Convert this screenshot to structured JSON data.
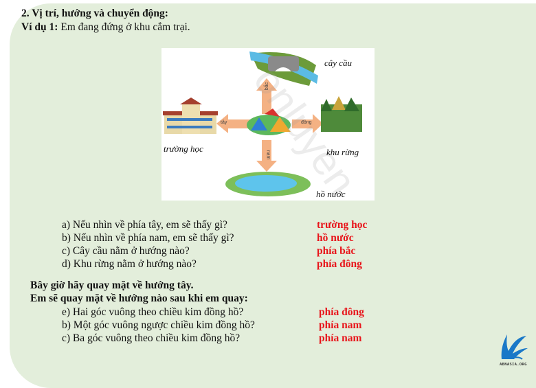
{
  "heading": {
    "title": "2. Vị trí, hướng và chuyển động:",
    "example_label": "Ví dụ 1:",
    "example_text": " Em đang đứng ở khu cắm trại."
  },
  "diagram": {
    "labels": {
      "north_place": "cây cầu",
      "west_place": "trường học",
      "east_place": "khu rừng",
      "south_place": "hồ nước"
    },
    "arrows": {
      "north": "bắc",
      "south": "nam",
      "west": "tây",
      "east": "đông"
    },
    "arrow_color": "#f4b183"
  },
  "questions": [
    {
      "q": "a) Nếu nhìn về phía tây, em sẽ thấy gì?",
      "a": "trường học"
    },
    {
      "q": "b) Nếu nhìn về phía nam, em sẽ thấy gì?",
      "a": "hồ nước"
    },
    {
      "q": "c) Cây cầu nằm ở hướng nào?",
      "a": "phía bắc"
    },
    {
      "q": "d) Khu rừng nằm ở hướng nào?",
      "a": "phía đông"
    }
  ],
  "turn": {
    "line1": "Bây giờ hãy quay mặt về hướng tây.",
    "line2": "Em sẽ quay mặt về hướng nào sau khi em quay:",
    "questions": [
      {
        "q": "e) Hai góc vuông theo chiều kim đồng hồ?",
        "a": "phía đông"
      },
      {
        "q": "b) Một góc vuông ngược chiều kim đồng hồ?",
        "a": "phía nam"
      },
      {
        "q": "c) Ba góc vuông theo chiều kim đồng hồ?",
        "a": "phía nam"
      }
    ]
  },
  "answer_color": "#e8141a",
  "background_color": "#e3eedb",
  "logo": {
    "text": "ABNASIA.ORG"
  }
}
